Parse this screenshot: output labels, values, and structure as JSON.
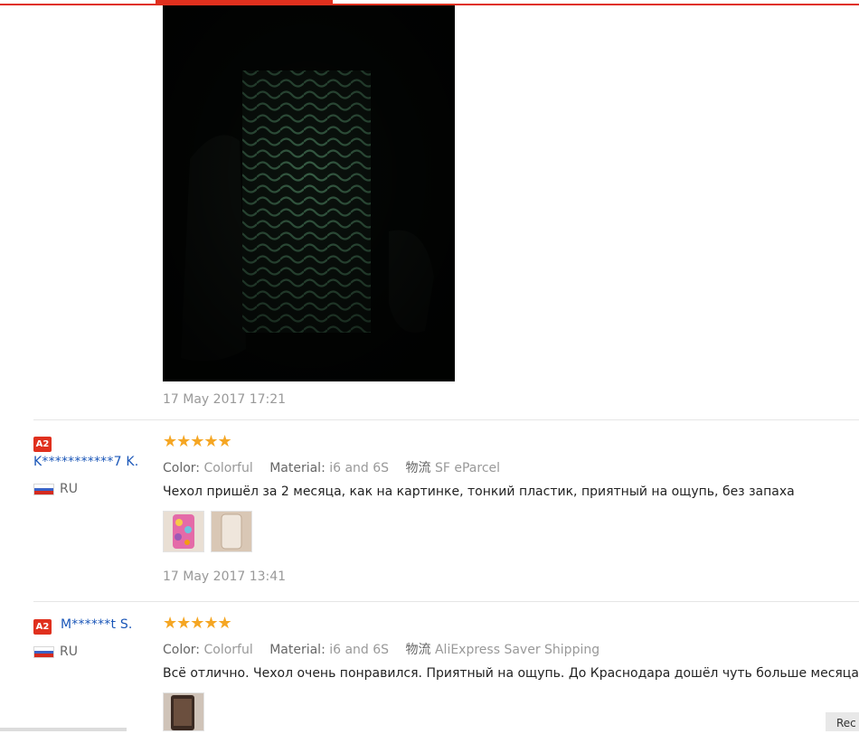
{
  "reviews": [
    {
      "date": "17 May 2017 17:21"
    },
    {
      "badge": "A2",
      "user": "K***********7 K.",
      "country": "RU",
      "stars": "★★★★★",
      "color_label": "Color:",
      "color_value": "Colorful",
      "material_label": "Material:",
      "material_value": "i6 and 6S",
      "shipping_label": "物流",
      "shipping_value": "SF eParcel",
      "text": "Чехол пришёл за 2 месяца, как на картинке, тонкий пластик, приятный на ощупь, без запаха",
      "date": "17 May 2017 13:41"
    },
    {
      "badge": "A2",
      "user": "M******t S.",
      "country": "RU",
      "stars": "★★★★★",
      "color_label": "Color:",
      "color_value": "Colorful",
      "material_label": "Material:",
      "material_value": "i6 and 6S",
      "shipping_label": "物流",
      "shipping_value": "AliExpress Saver Shipping",
      "text": "Всё отлично. Чехол очень понравился. Приятный на ощупь. До Краснодара дошёл чуть больше месяца."
    }
  ],
  "more_button": "Rec",
  "colors": {
    "accent": "#e0301e",
    "star": "#f5a623",
    "link": "#1a56b8"
  }
}
